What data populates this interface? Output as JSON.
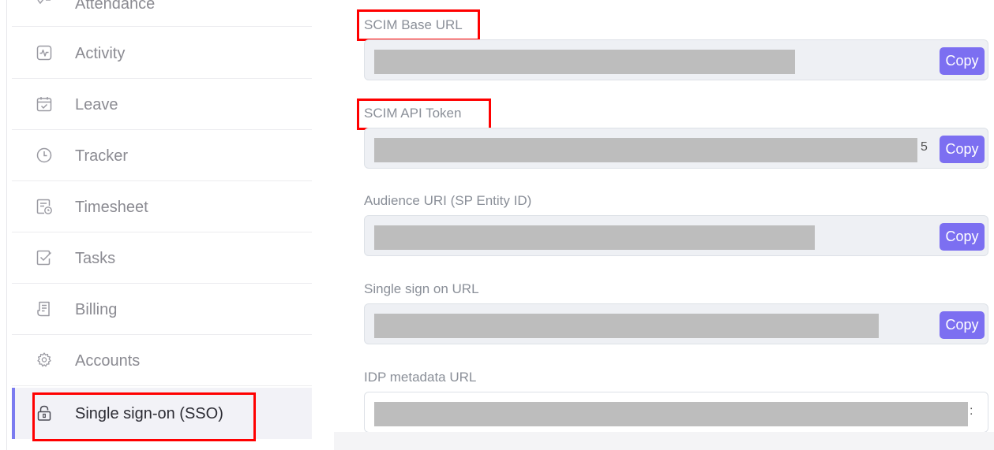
{
  "sidebar": {
    "cut_item": {
      "label": "Attendance"
    },
    "items": [
      {
        "label": "Activity",
        "icon": "activity-icon"
      },
      {
        "label": "Leave",
        "icon": "calendar-check-icon"
      },
      {
        "label": "Tracker",
        "icon": "clock-icon"
      },
      {
        "label": "Timesheet",
        "icon": "timesheet-icon"
      },
      {
        "label": "Tasks",
        "icon": "task-check-icon"
      },
      {
        "label": "Billing",
        "icon": "receipt-icon"
      },
      {
        "label": "Accounts",
        "icon": "gear-icon"
      },
      {
        "label": "Single sign-on (SSO)",
        "icon": "lock-icon",
        "active": true
      }
    ]
  },
  "fields": [
    {
      "label": "SCIM Base URL",
      "copy_label": "Copy",
      "highlighted": true
    },
    {
      "label": "SCIM API Token",
      "copy_label": "Copy",
      "highlighted": true,
      "overflow_char": "5"
    },
    {
      "label": "Audience URI (SP Entity ID)",
      "copy_label": "Copy"
    },
    {
      "label": "Single sign on URL",
      "copy_label": "Copy"
    },
    {
      "label": "IDP metadata URL",
      "overflow_char": ":"
    }
  ],
  "colors": {
    "accent": "#7c6ff1",
    "active_bar": "#7b7bf0",
    "highlight": "#ff0000",
    "redaction": "#bdbdbd"
  }
}
